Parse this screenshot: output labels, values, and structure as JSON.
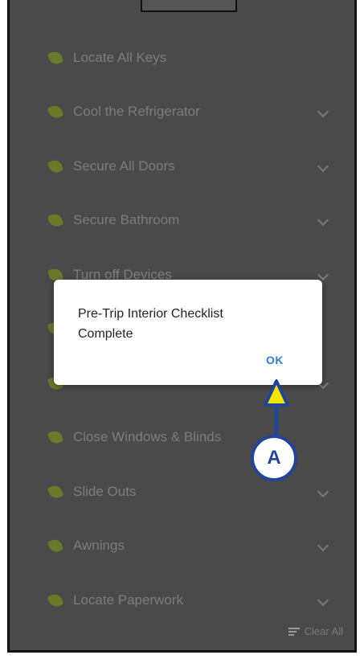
{
  "checklist": {
    "items": [
      {
        "label": "Locate All Keys",
        "has_chevron": false
      },
      {
        "label": "Cool the Refrigerator",
        "has_chevron": true
      },
      {
        "label": "Secure All Doors",
        "has_chevron": true
      },
      {
        "label": "Secure Bathroom",
        "has_chevron": true
      },
      {
        "label": "Turn off Devices",
        "has_chevron": true
      },
      {
        "label": "",
        "has_chevron": false
      },
      {
        "label": "",
        "has_chevron": true
      },
      {
        "label": "Close Windows & Blinds",
        "has_chevron": false
      },
      {
        "label": "Slide Outs",
        "has_chevron": true
      },
      {
        "label": "Awnings",
        "has_chevron": true
      },
      {
        "label": "Locate Paperwork",
        "has_chevron": true
      }
    ],
    "clear_all_label": "Clear All"
  },
  "dialog": {
    "message": "Pre-Trip Interior Checklist Complete",
    "ok_label": "OK"
  },
  "annotation": {
    "callout_label": "A"
  },
  "colors": {
    "overlay_bg": "#4a4a4a",
    "ok_blue": "#2d7fd6",
    "callout_blue": "#22449a",
    "arrow_yellow": "#f5e600"
  }
}
